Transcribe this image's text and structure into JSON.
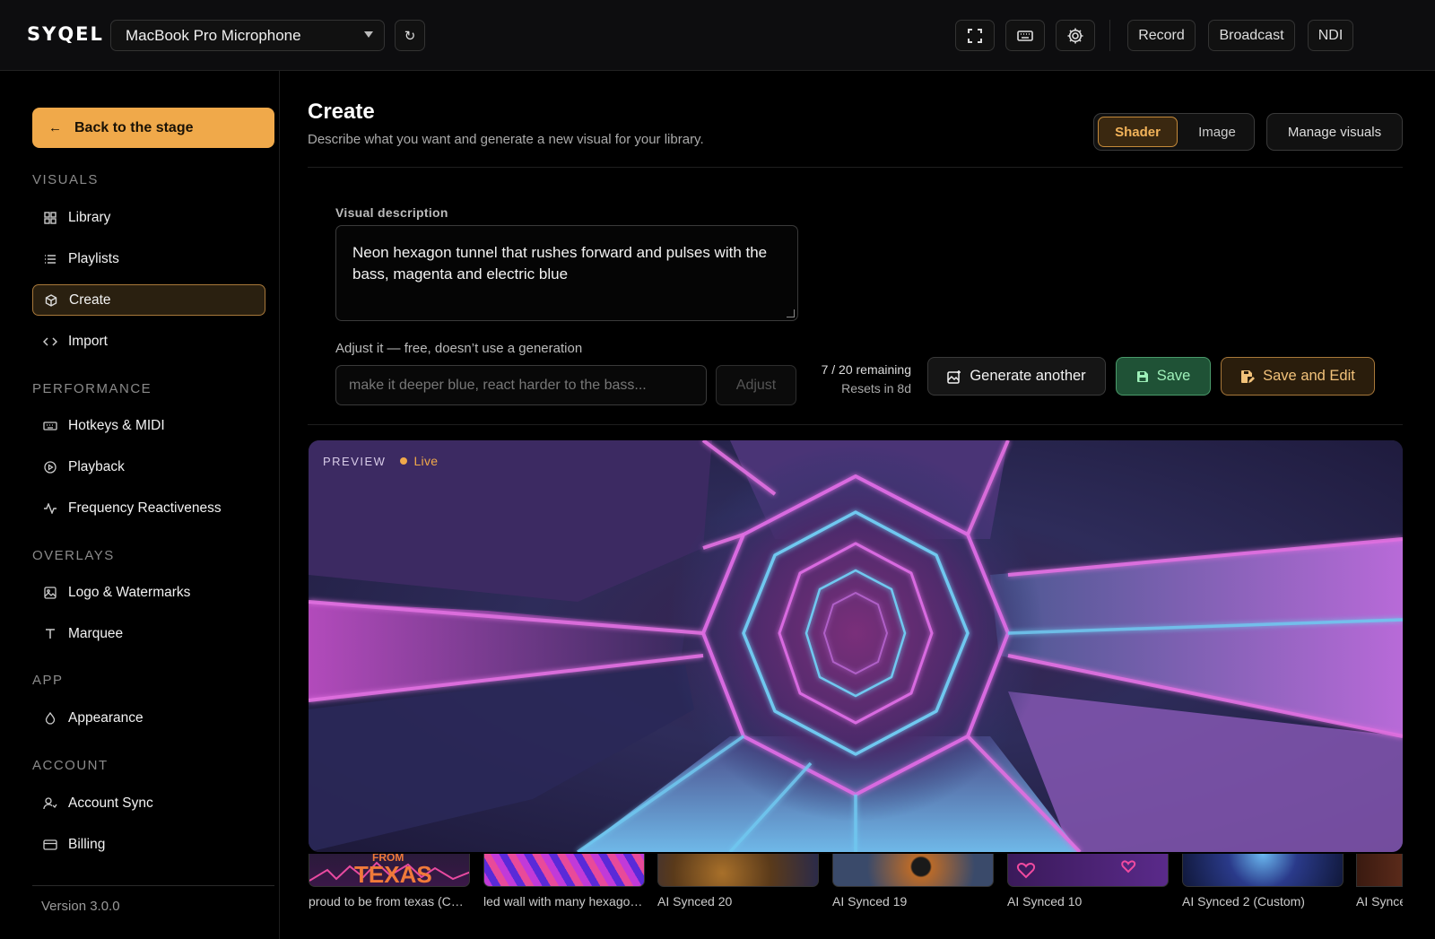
{
  "app": {
    "logo": "SYQEL"
  },
  "topbar": {
    "mic_select": "MacBook Pro Microphone",
    "refresh_glyph": "↻",
    "icons": [
      "fullscreen-icon",
      "keyboard-icon",
      "settings-icon"
    ],
    "record": "Record",
    "broadcast": "Broadcast",
    "ndi": "NDI"
  },
  "sidebar": {
    "back": "Back to the stage",
    "sections": {
      "visuals": "VISUALS",
      "performance": "PERFORMANCE",
      "overlays": "OVERLAYS",
      "app": "APP",
      "account": "ACCOUNT"
    },
    "items": {
      "library": "Library",
      "playlists": "Playlists",
      "create": "Create",
      "import": "Import",
      "hotkeys": "Hotkeys & MIDI",
      "playback": "Playback",
      "frequency": "Frequency Reactiveness",
      "logo": "Logo & Watermarks",
      "marquee": "Marquee",
      "appearance": "Appearance",
      "account_sync": "Account Sync",
      "billing": "Billing"
    },
    "active": "create",
    "version": "Version 3.0.0"
  },
  "main": {
    "title": "Create",
    "subtitle": "Describe what you want and generate a new visual for your library.",
    "segmented": {
      "shader": "Shader",
      "image": "Image",
      "selected": "shader"
    },
    "manage": "Manage visuals",
    "description_label": "Visual description",
    "description_value": "Neon hexagon tunnel that rushes forward and pulses with the bass, magenta and electric blue",
    "adjust_label": "Adjust it — free, doesn’t use a generation",
    "adjust_placeholder": "make it deeper blue, react harder to the bass...",
    "adjust_button": "Adjust",
    "remaining": "7 / 20 remaining",
    "resets": "Resets in 8d",
    "generate_another": "Generate another",
    "save": "Save",
    "save_and_edit": "Save and Edit",
    "preview_label": "PREVIEW",
    "preview_status": "Live"
  },
  "thumbnails": [
    {
      "caption": "proud to be from texas (C…",
      "overlay_text": "TEXAS",
      "overlay_top": "FROM"
    },
    {
      "caption": "led wall with many hexago…"
    },
    {
      "caption": "AI Synced 20"
    },
    {
      "caption": "AI Synced 19"
    },
    {
      "caption": "AI Synced 10"
    },
    {
      "caption": "AI Synced 2 (Custom)"
    },
    {
      "caption": "AI Synce"
    }
  ],
  "colors": {
    "accent": "#f0a94a",
    "save_green": "#1f5236",
    "background": "#000000",
    "neon_magenta": "#e24fd8",
    "neon_blue": "#5fb8f0"
  }
}
